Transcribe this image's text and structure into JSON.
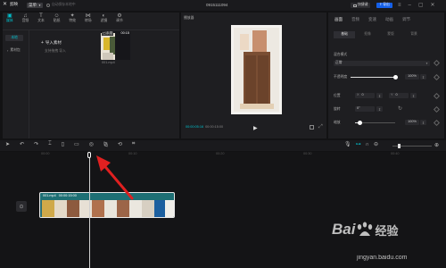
{
  "app": {
    "logo_text": "剪映",
    "menu_label": "菜单",
    "autosave_text": "自动保存本地中",
    "project_title": "0915111094",
    "shortcut_label": "快捷键",
    "export_label": "导出"
  },
  "media_tabs": [
    {
      "label": "媒体",
      "icon": "media-icon"
    },
    {
      "label": "音频",
      "icon": "audio-icon"
    },
    {
      "label": "文本",
      "icon": "text-icon"
    },
    {
      "label": "贴纸",
      "icon": "sticker-icon"
    },
    {
      "label": "特效",
      "icon": "effects-icon"
    },
    {
      "label": "转场",
      "icon": "transition-icon"
    },
    {
      "label": "滤镜",
      "icon": "filter-icon"
    },
    {
      "label": "调节",
      "icon": "adjust-icon"
    }
  ],
  "left_nav": {
    "local": "本地",
    "import": "素材包"
  },
  "import": {
    "label": "导入素材",
    "hint": "支持拖拽 导入"
  },
  "clip": {
    "added_badge": "已添加",
    "duration": "00:15",
    "filename": "001.mp4"
  },
  "player": {
    "title": "播放器",
    "current_time": "00:00:05:16",
    "total_time": "00:00:15:00"
  },
  "props": {
    "tabs": [
      "画面",
      "音频",
      "变速",
      "动画",
      "调节"
    ],
    "subtabs": [
      "基础",
      "抠像",
      "蒙版",
      "背景"
    ],
    "blend_label": "混合模式",
    "blend_value": "正常",
    "opacity_label": "不透明度",
    "opacity_value": "100%",
    "opacity_level": 1.0,
    "position_label": "位置",
    "x_label": "X",
    "x_value": "0",
    "y_label": "Y",
    "y_value": "0",
    "rotate_label": "旋转",
    "rotate_value": "0°",
    "scale_label": "缩放",
    "scale_value": "100%",
    "scale_level": 0.12
  },
  "timeline": {
    "ticks": [
      "00:00",
      "00:10",
      "00:20",
      "00:30",
      "00:40",
      "00:50"
    ],
    "clip_label": "001.mp4",
    "clip_duration": "00:00:15:00"
  },
  "watermark": {
    "brand": "Bai",
    "brand2": "经验",
    "url": "jingyan.baidu.com"
  },
  "colors": {
    "accent": "#00c1cd",
    "clip_bg": "#1e6f74",
    "arrow": "#e02020",
    "export_btn": "#1560e8"
  }
}
